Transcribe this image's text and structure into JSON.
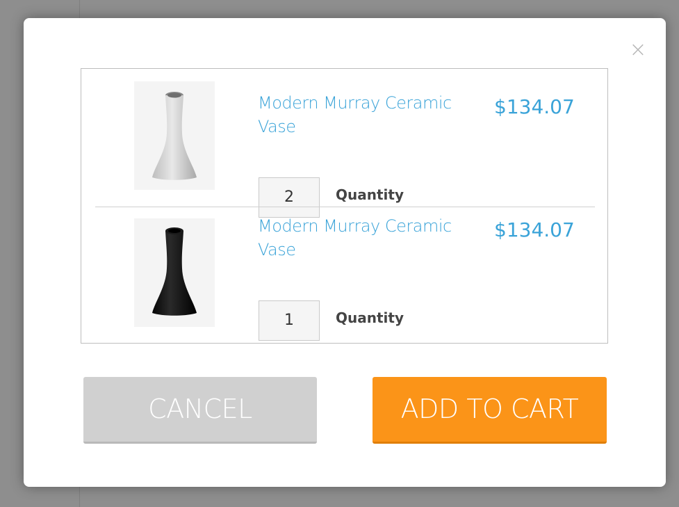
{
  "modal": {
    "close_glyph": "×",
    "items": [
      {
        "name": "Modern Murray Ceramic Vase",
        "price": "$134.07",
        "quantity": "2",
        "quantity_label": "Quantity",
        "vase_color": "#d6d6d6"
      },
      {
        "name": "Modern Murray Ceramic Vase",
        "price": "$134.07",
        "quantity": "1",
        "quantity_label": "Quantity",
        "vase_color": "#111111"
      }
    ],
    "cancel_label": "CANCEL",
    "add_to_cart_label": "ADD TO CART"
  },
  "colors": {
    "link_blue": "#3aa3d8",
    "add_orange": "#fb9418",
    "cancel_gray": "#d0d0d0"
  }
}
